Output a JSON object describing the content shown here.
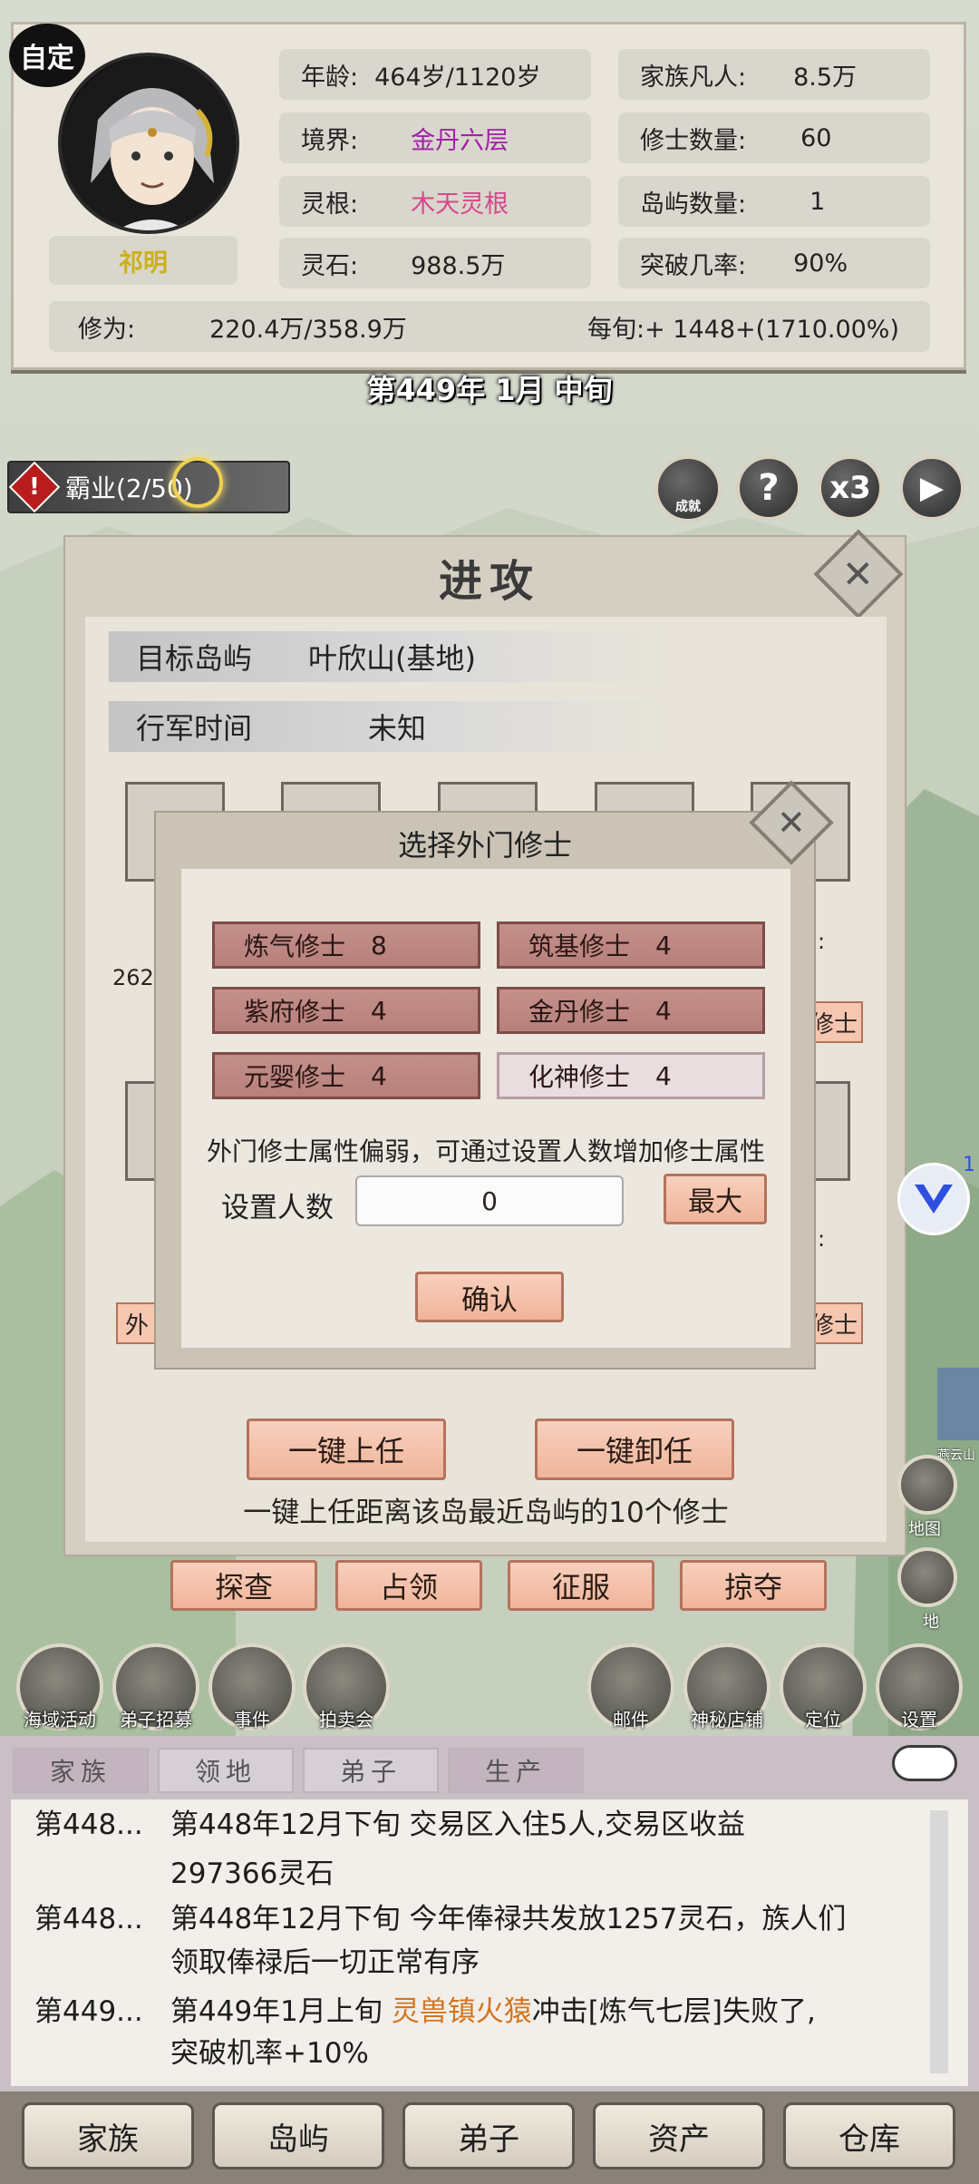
{
  "auto_badge": "自定",
  "profile": {
    "name": "祁明",
    "stats": {
      "age_label": "年龄:",
      "age_value": "464岁/1120岁",
      "realm_label": "境界:",
      "realm_value": "金丹六层",
      "root_label": "灵根:",
      "root_value": "木天灵根",
      "stone_label": "灵石:",
      "stone_value": "988.5万",
      "family_label": "家族凡人:",
      "family_value": "8.5万",
      "cultivators_label": "修士数量:",
      "cultivators_value": "60",
      "islands_label": "岛屿数量:",
      "islands_value": "1",
      "breakthrough_label": "突破几率:",
      "breakthrough_value": "90%"
    },
    "cultivation_label": "修为:",
    "cultivation_value": "220.4万/358.9万",
    "per_period": "每旬:+ 1448+(1710.00%)"
  },
  "date_banner": "第449年 1月 中旬",
  "quest": {
    "label": "霸业(2/50)"
  },
  "top_buttons": {
    "achievement": "成就",
    "help": "?",
    "speed": "x3",
    "play": "▶"
  },
  "attack_panel": {
    "title": "进攻",
    "target_label": "目标岛屿",
    "target_value": "叶欣山(基地)",
    "march_label": "行军时间",
    "march_value": "未知",
    "partial_text_1": "262",
    "partial_text_2": "外",
    "partial_right_1": "修士",
    "partial_right_2": "修士",
    "partial_colon_1": ":",
    "partial_colon_2": ":",
    "assign_all": "一键上任",
    "dismiss_all": "一键卸任",
    "hint": "一键上任距离该岛最近岛屿的10个修士",
    "actions": [
      "探查",
      "占领",
      "征服",
      "掠夺"
    ]
  },
  "select_dialog": {
    "title": "选择外门修士",
    "cultivators": [
      {
        "name": "炼气修士",
        "count": "8"
      },
      {
        "name": "筑基修士",
        "count": "4"
      },
      {
        "name": "紫府修士",
        "count": "4"
      },
      {
        "name": "金丹修士",
        "count": "4"
      },
      {
        "name": "元婴修士",
        "count": "4"
      },
      {
        "name": "化神修士",
        "count": "4"
      }
    ],
    "note": "外门修士属性偏弱，可通过设置人数增加修士属性",
    "set_label": "设置人数",
    "input_value": "0",
    "max_button": "最大",
    "confirm": "确认"
  },
  "side_badge": "1",
  "map_labels": {
    "ground": "地图",
    "land": "地",
    "mountain": "燕云山"
  },
  "bottom_icons": {
    "left": [
      "海域活动",
      "弟子招募",
      "事件",
      "拍卖会"
    ],
    "right": [
      "邮件",
      "神秘店铺",
      "定位",
      "设置"
    ]
  },
  "log_tabs": [
    "家族",
    "领地",
    "弟子",
    "生产"
  ],
  "log_entries": [
    {
      "date": "第448...",
      "text": "第448年12月下旬 交易区入住5人,交易区收益",
      "text2": "297366灵石"
    },
    {
      "date": "第448...",
      "text": "第448年12月下旬 今年俸禄共发放1257灵石，族人们",
      "text2": "领取俸禄后一切正常有序"
    },
    {
      "date": "第449...",
      "pre": "第449年1月上旬 ",
      "highlight": "灵兽镇火猿",
      "post": "冲击[炼气七层]失败了,",
      "text2": "突破机率+10%"
    }
  ],
  "nav": [
    "家族",
    "岛屿",
    "弟子",
    "资产",
    "仓库"
  ],
  "colors": {
    "accent_pink": "#f0b49a",
    "realm_purple": "#a11fa8",
    "root_pink": "#d9468a",
    "highlight_orange": "#d3751e"
  }
}
